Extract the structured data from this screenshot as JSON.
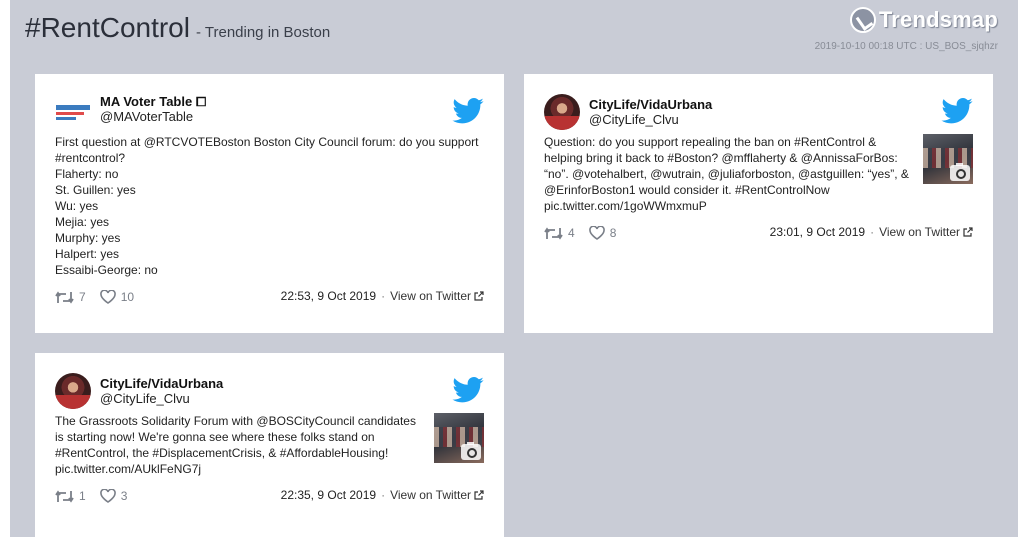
{
  "header": {
    "hashtag": "#RentControl",
    "subtitle": "- Trending in Boston",
    "brand": "Trendsmap",
    "stamp": "2019-10-10 00:18 UTC : US_BOS_sjqhzr"
  },
  "colors": {
    "twitter_blue": "#1da1f2",
    "background": "#c9ccd6"
  },
  "tweets": [
    {
      "name": "MA Voter Table ⧠",
      "handle": "@MAVoterTable",
      "text": "First question at @RTCVOTEBoston Boston City Council forum: do you support #rentcontrol?\nFlaherty: no\nSt. Guillen: yes\nWu: yes\nMejia: yes\nMurphy: yes\nHalpert: yes\nEssaibi-George: no",
      "retweets": "7",
      "likes": "10",
      "time": "22:53, 9 Oct 2019",
      "view_label": "View on Twitter"
    },
    {
      "name": "CityLife/VidaUrbana",
      "handle": "@CityLife_Clvu",
      "text": "Question: do you support repealing the ban on #RentControl & helping bring it back to #Boston? @mfflaherty & @AnnissaForBos: “no”. @votehalbert, @wutrain, @juliaforboston, @astguillen: “yes”, & @ErinforBoston1 would consider it. #RentControlNow pic.twitter.com/1goWWmxmuP",
      "retweets": "4",
      "likes": "8",
      "time": "23:01, 9 Oct 2019",
      "view_label": "View on Twitter"
    },
    {
      "name": "CityLife/VidaUrbana",
      "handle": "@CityLife_Clvu",
      "text": "The Grassroots Solidarity Forum with @BOSCityCouncil candidates is starting now! We're gonna see where these folks stand on #RentControl, the #DisplacementCrisis, & #AffordableHousing! pic.twitter.com/AUklFeNG7j",
      "retweets": "1",
      "likes": "3",
      "time": "22:35, 9 Oct 2019",
      "view_label": "View on Twitter"
    }
  ]
}
